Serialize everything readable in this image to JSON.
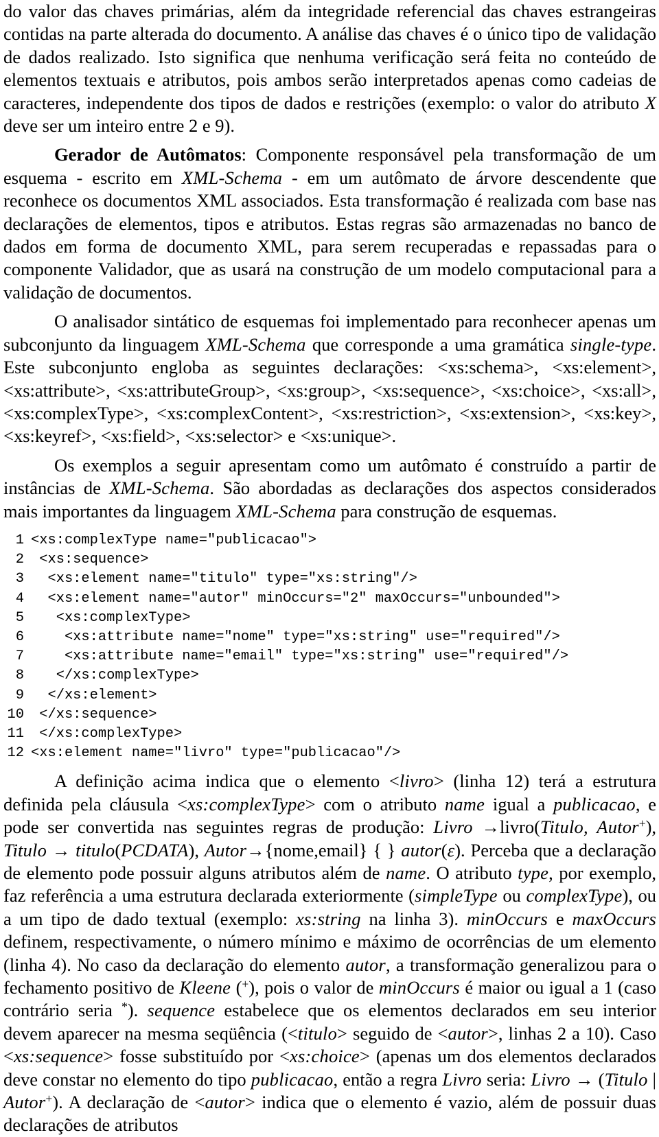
{
  "document": {
    "language": "pt-BR",
    "type": "academic-paper-page",
    "paragraphs": {
      "p1": {
        "parts": [
          {
            "text": "do valor das chaves primárias, além da integridade referencial das chaves estrangeiras contidas na parte alterada do documento. A análise das chaves é o único tipo de validação de dados realizado.  Isto significa que nenhuma verificação será feita no conteúdo de elementos textuais e atributos, pois ambos serão interpretados apenas como cadeias de caracteres, independente dos tipos de dados e restrições (exemplo: o valor do atributo "
          },
          {
            "text": "X",
            "style": "mathit"
          },
          {
            "text": " deve ser um inteiro entre 2 e 9)."
          }
        ]
      },
      "p2": {
        "heading": "Gerador de Autômatos",
        "parts": [
          {
            "text": ": Componente responsável pela transformação de um esquema - escrito em "
          },
          {
            "text": "XML-Schema",
            "style": "mathit"
          },
          {
            "text": " - em um autômato de árvore descendente que reconhece os documentos XML associados.  Esta transformação é realizada com base nas declarações de elementos, tipos e atributos.  Estas regras são armazenadas no banco de dados em forma de documento XML, para serem recuperadas e repassadas para o componente Validador, que as usará na construção de um modelo computacional para a validação de documentos."
          }
        ]
      },
      "p3": {
        "parts": [
          {
            "text": "O analisador sintático de esquemas foi implementado para reconhecer apenas um subconjunto da linguagem "
          },
          {
            "text": "XML-Schema",
            "style": "mathit"
          },
          {
            "text": " que corresponde a uma gramática "
          },
          {
            "text": "single-type",
            "style": "mathit"
          },
          {
            "text": ".   Este subconjunto engloba as seguintes declarações:  <xs:schema>, <xs:element>,  <xs:attribute>,  <xs:attributeGroup>,  <xs:group>,  <xs:sequence>, <xs:choice>, <xs:all>, <xs:complexType>, <xs:complexContent>, <xs:restriction>, <xs:extension>, <xs:key>, <xs:keyref>, <xs:field>, <xs:selector> e <xs:unique>."
          }
        ]
      },
      "p4": {
        "parts": [
          {
            "text": "Os exemplos a seguir apresentam como um autômato é construído a partir de instâncias de "
          },
          {
            "text": "XML-Schema",
            "style": "mathit"
          },
          {
            "text": ".  São abordadas as declarações dos aspectos considerados mais importantes da linguagem "
          },
          {
            "text": "XML-Schema",
            "style": "mathit"
          },
          {
            "text": " para construção de esquemas."
          }
        ]
      },
      "p5": {
        "parts": [
          {
            "text": "A definição acima indica que o elemento <"
          },
          {
            "text": "livro",
            "style": "mathit"
          },
          {
            "text": "> (linha 12) terá a estrutura definida pela cláusula <"
          },
          {
            "text": "xs:complexType",
            "style": "mathit"
          },
          {
            "text": "> com o atributo "
          },
          {
            "text": "name",
            "style": "mathit"
          },
          {
            "text": " igual a "
          },
          {
            "text": "publicacao",
            "style": "mathit"
          },
          {
            "text": ", e pode ser convertida nas seguintes regras de produção: "
          },
          {
            "text": "Livro",
            "style": "mathit"
          },
          {
            "text": " →",
            "style": "arrow"
          },
          {
            "text": "livro"
          },
          {
            "text": "("
          },
          {
            "text": "Titulo, Autor",
            "style": "mathit"
          },
          {
            "text": "+",
            "style": "sup"
          },
          {
            "text": "), "
          },
          {
            "text": "Titulo",
            "style": "mathit"
          },
          {
            "text": " → "
          },
          {
            "text": "titulo",
            "style": "mathit"
          },
          {
            "text": "("
          },
          {
            "text": "PCDATA",
            "style": "mathit"
          },
          {
            "text": "), "
          },
          {
            "text": "Autor",
            "style": "mathit"
          },
          {
            "text": "→{nome,email} { }   "
          },
          {
            "text": "autor",
            "style": "mathit"
          },
          {
            "text": "("
          },
          {
            "text": "ε",
            "style": "mathit"
          },
          {
            "text": ").  Perceba que a declaração de elemento pode possuir alguns atributos além de "
          },
          {
            "text": "name",
            "style": "mathit"
          },
          {
            "text": ".   O atributo "
          },
          {
            "text": "type",
            "style": "mathit"
          },
          {
            "text": ", por exemplo, faz referência a uma estrutura declarada exteriormente ("
          },
          {
            "text": "simpleType",
            "style": "mathit"
          },
          {
            "text": " ou "
          },
          {
            "text": "complexType",
            "style": "mathit"
          },
          {
            "text": "), ou a um tipo de dado textual (exemplo:  "
          },
          {
            "text": "xs:string",
            "style": "mathit"
          },
          {
            "text": " na linha 3). "
          },
          {
            "text": "minOccurs",
            "style": "mathit"
          },
          {
            "text": " e "
          },
          {
            "text": "maxOccurs",
            "style": "mathit"
          },
          {
            "text": " definem, respectivamente, o número mínimo e máximo de ocorrências de um elemento (linha 4).  No caso da declaração do elemento "
          },
          {
            "text": "autor",
            "style": "mathit"
          },
          {
            "text": ", a transformação generalizou para o fechamento positivo de "
          },
          {
            "text": "Kleene",
            "style": "mathit"
          },
          {
            "text": " ("
          },
          {
            "text": "+",
            "style": "sup"
          },
          {
            "text": "), pois o valor de "
          },
          {
            "text": "minOccurs",
            "style": "mathit"
          },
          {
            "text": " é maior ou igual a 1 (caso contrário seria "
          },
          {
            "text": "*",
            "style": "sup"
          },
          {
            "text": "). "
          },
          {
            "text": "sequence",
            "style": "mathit"
          },
          {
            "text": " estabelece que os elementos declarados em seu interior devem aparecer na mesma seqüência (<"
          },
          {
            "text": "titulo",
            "style": "mathit"
          },
          {
            "text": "> seguido de <"
          },
          {
            "text": "autor",
            "style": "mathit"
          },
          {
            "text": ">, linhas 2 a 10).  Caso <"
          },
          {
            "text": "xs:sequence",
            "style": "mathit"
          },
          {
            "text": "> fosse substituído por <"
          },
          {
            "text": "xs:choice",
            "style": "mathit"
          },
          {
            "text": "> (apenas um dos elementos declarados deve constar no elemento do tipo "
          },
          {
            "text": "publicacao",
            "style": "mathit"
          },
          {
            "text": ", então a regra "
          },
          {
            "text": "Livro",
            "style": "mathit"
          },
          {
            "text": " seria: "
          },
          {
            "text": "Livro",
            "style": "mathit"
          },
          {
            "text": " → ("
          },
          {
            "text": "Titulo",
            "style": "mathit"
          },
          {
            "text": " | "
          },
          {
            "text": "Autor",
            "style": "mathit"
          },
          {
            "text": "+",
            "style": "sup"
          },
          {
            "text": ").  A declaração de <"
          },
          {
            "text": "autor",
            "style": "mathit"
          },
          {
            "text": "> indica que o elemento é vazio, além de possuir duas declarações de atributos"
          }
        ]
      }
    },
    "code_listing": {
      "language": "xml",
      "lines": [
        {
          "n": "1",
          "indent": 0,
          "text": "<xs:complexType name=\"publicacao\">"
        },
        {
          "n": "2",
          "indent": 1,
          "text": "<xs:sequence>"
        },
        {
          "n": "3",
          "indent": 2,
          "text": "<xs:element name=\"titulo\" type=\"xs:string\"/>"
        },
        {
          "n": "4",
          "indent": 2,
          "text": "<xs:element name=\"autor\" minOccurs=\"2\" maxOccurs=\"unbounded\">"
        },
        {
          "n": "5",
          "indent": 3,
          "text": "<xs:complexType>"
        },
        {
          "n": "6",
          "indent": 4,
          "text": "<xs:attribute name=\"nome\" type=\"xs:string\" use=\"required\"/>"
        },
        {
          "n": "7",
          "indent": 4,
          "text": "<xs:attribute name=\"email\" type=\"xs:string\" use=\"required\"/>"
        },
        {
          "n": "8",
          "indent": 3,
          "text": "</xs:complexType>"
        },
        {
          "n": "9",
          "indent": 2,
          "text": "</xs:element>"
        },
        {
          "n": "10",
          "indent": 1,
          "text": "</xs:sequence>"
        },
        {
          "n": "11",
          "indent": 1,
          "text": "</xs:complexType>"
        },
        {
          "n": "12",
          "indent": 0,
          "text": "<xs:element name=\"livro\" type=\"publicacao\"/>"
        }
      ]
    }
  }
}
